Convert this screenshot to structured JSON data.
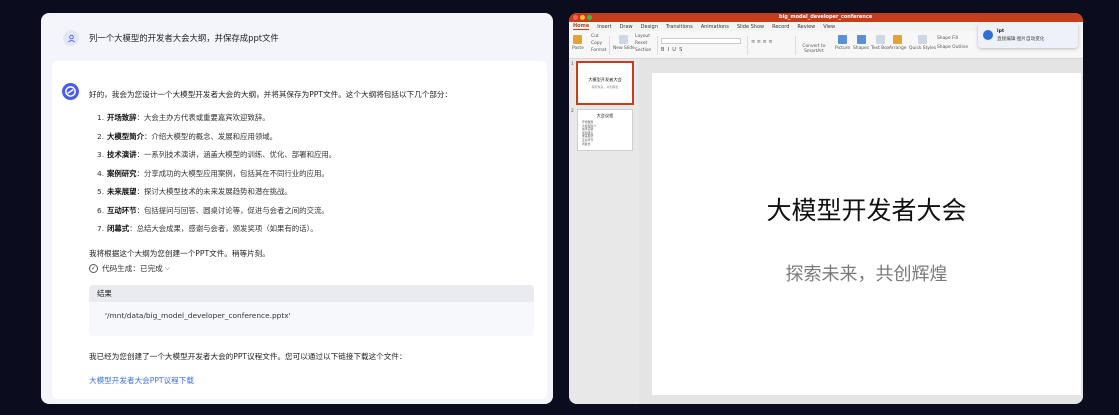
{
  "chat": {
    "user_message": "列一个大模型的开发者大会大纲，并保存成ppt文件",
    "intro": "好的，我会为您设计一个大模型开发者大会的大纲，并将其保存为PPT文件。这个大纲将包括以下几个部分：",
    "outline": [
      {
        "num": "1.",
        "title": "开场致辞",
        "desc": "：大会主办方代表或重要嘉宾欢迎致辞。"
      },
      {
        "num": "2.",
        "title": "大模型简介",
        "desc": "：介绍大模型的概念、发展和应用领域。"
      },
      {
        "num": "3.",
        "title": "技术演讲",
        "desc": "：一系列技术演讲，涵盖大模型的训练、优化、部署和应用。"
      },
      {
        "num": "4.",
        "title": "案例研究",
        "desc": "：分享成功的大模型应用案例，包括其在不同行业的应用。"
      },
      {
        "num": "5.",
        "title": "未来展望",
        "desc": "：探讨大模型技术的未来发展趋势和潜在挑战。"
      },
      {
        "num": "6.",
        "title": "互动环节",
        "desc": "：包括提问与回答、圆桌讨论等，促进与会者之间的交流。"
      },
      {
        "num": "7.",
        "title": "闭幕式",
        "desc": "：总结大会成果，感谢与会者，颁发奖项（如果有的话）。"
      }
    ],
    "creating_text": "我将根据这个大纲为您创建一个PPT文件。稍等片刻。",
    "code_status": "代码生成：已完成",
    "result_label": "结果",
    "result_value": "'/mnt/data/big_model_developer_conference.pptx'",
    "done_text": "我已经为您创建了一个大模型开发者大会的PPT议程文件。您可以通过以下链接下载这个文件：",
    "download_link": "大模型开发者大会PPT议程下载"
  },
  "ppt": {
    "window_title": "big_model_developer_conference",
    "tabs": [
      "Home",
      "Insert",
      "Draw",
      "Design",
      "Transitions",
      "Animations",
      "Slide Show",
      "Record",
      "Review",
      "View"
    ],
    "active_tab": "Home",
    "ribbon": {
      "paste": "Paste",
      "cut": "Cut",
      "copy": "Copy",
      "format": "Format",
      "new_slide": "New Slide",
      "layout": "Layout",
      "reset": "Reset",
      "section": "Section",
      "convert": "Convert to SmartArt",
      "picture": "Picture",
      "shapes": "Shapes",
      "textbox": "Text Box",
      "arrange": "Arrange",
      "quick_styles": "Quick Styles",
      "shape_fill": "Shape Fill",
      "shape_outline": "Shape Outline"
    },
    "notification": {
      "title": "lpt",
      "text": "直接编辑·图片自动变化"
    },
    "thumbnails": [
      {
        "num": "1",
        "title": "大模型开发者大会",
        "subtitle": "探索未来，共创辉煌"
      },
      {
        "num": "2",
        "title": "大会议程",
        "items": [
          "开场致辞",
          "大模型简介",
          "技术演讲",
          "案例研究",
          "未来展望",
          "互动环节",
          "闭幕式"
        ]
      }
    ],
    "slide": {
      "title": "大模型开发者大会",
      "subtitle": "探索未来，共创辉煌"
    }
  },
  "colors": {
    "background": "#0b0c1e",
    "accent_ppt": "#c43e1c",
    "link": "#3d6ee8",
    "bot_avatar": "#4a5cf0"
  }
}
